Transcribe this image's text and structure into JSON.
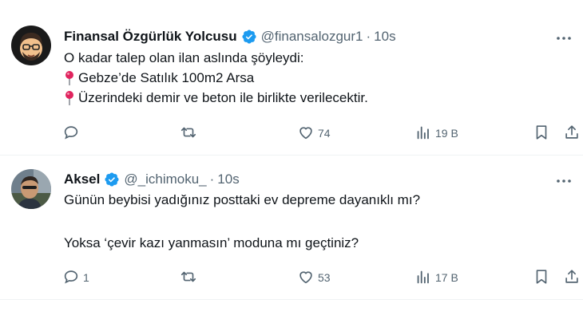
{
  "tweets": [
    {
      "author_name": "Finansal Özgürlük Yolcusu",
      "handle": "@finansalozgur1",
      "separator": "·",
      "time": "10s",
      "lines": [
        "O kadar talep olan ilan aslında şöyleydi:",
        "Gebze’de Satılık 100m2 Arsa",
        "Üzerindeki demir ve beton ile birlikte verilecektir."
      ],
      "replies": "",
      "retweets": "",
      "likes": "74",
      "views": "19 B"
    },
    {
      "author_name": "Aksel",
      "handle": "@_ichimoku_",
      "separator": "·",
      "time": "10s",
      "lines": [
        "Günün beybisi yadığınız posttaki ev depreme dayanıklı mı?",
        "",
        "Yoksa ‘çevir kazı yanmasın’ moduna mı geçtiniz?"
      ],
      "replies": "1",
      "retweets": "",
      "likes": "53",
      "views": "17 B"
    }
  ],
  "colors": {
    "text": "#0f1419",
    "secondary": "#536471",
    "verified": "#1d9bf0",
    "pin": "#e0245e",
    "divider": "#eff3f4"
  },
  "icons": [
    "verified-badge-icon",
    "more-icon",
    "pin-icon",
    "reply-icon",
    "retweet-icon",
    "like-icon",
    "views-icon",
    "bookmark-icon",
    "share-icon"
  ]
}
